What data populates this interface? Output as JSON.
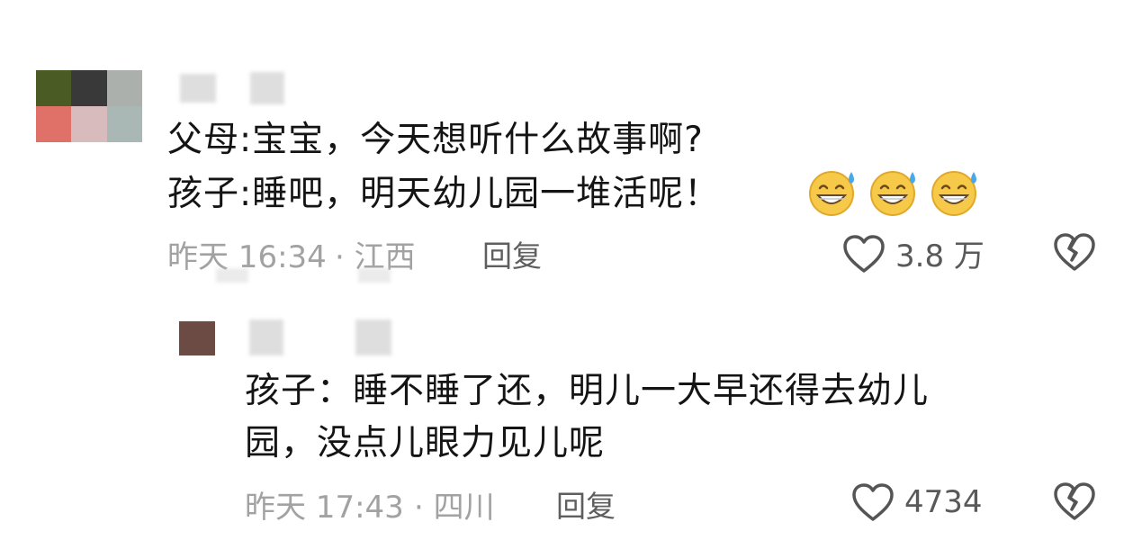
{
  "colors": {
    "avatar1": [
      "#4a5b24",
      "#393939",
      "#acb0ad",
      "#e07168",
      "#d8bcbd",
      "#a9b8b5"
    ],
    "avatar2": [
      "#6c4b45"
    ],
    "meta_text": "#a2a2a2",
    "body_text": "#141414",
    "icon": "#555555"
  },
  "comments": [
    {
      "lines": [
        "父母:宝宝，今天想听什么故事啊?",
        "孩子:睡吧，明天幼儿园一堆活呢！"
      ],
      "emojis": [
        "grinning-sweat-emoji",
        "grinning-sweat-emoji",
        "grinning-sweat-emoji"
      ],
      "time": "昨天 16:34",
      "location": "· 江西",
      "reply_label": "回复",
      "likes": "3.8 万"
    },
    {
      "lines": [
        "孩子：睡不睡了还，明儿一大早还得去幼儿",
        "园，没点儿眼力见儿呢"
      ],
      "time": "昨天 17:43",
      "location": "· 四川",
      "reply_label": "回复",
      "likes": "4734"
    }
  ],
  "icons": {
    "like": "heart-outline-icon",
    "dislike": "broken-heart-icon"
  }
}
